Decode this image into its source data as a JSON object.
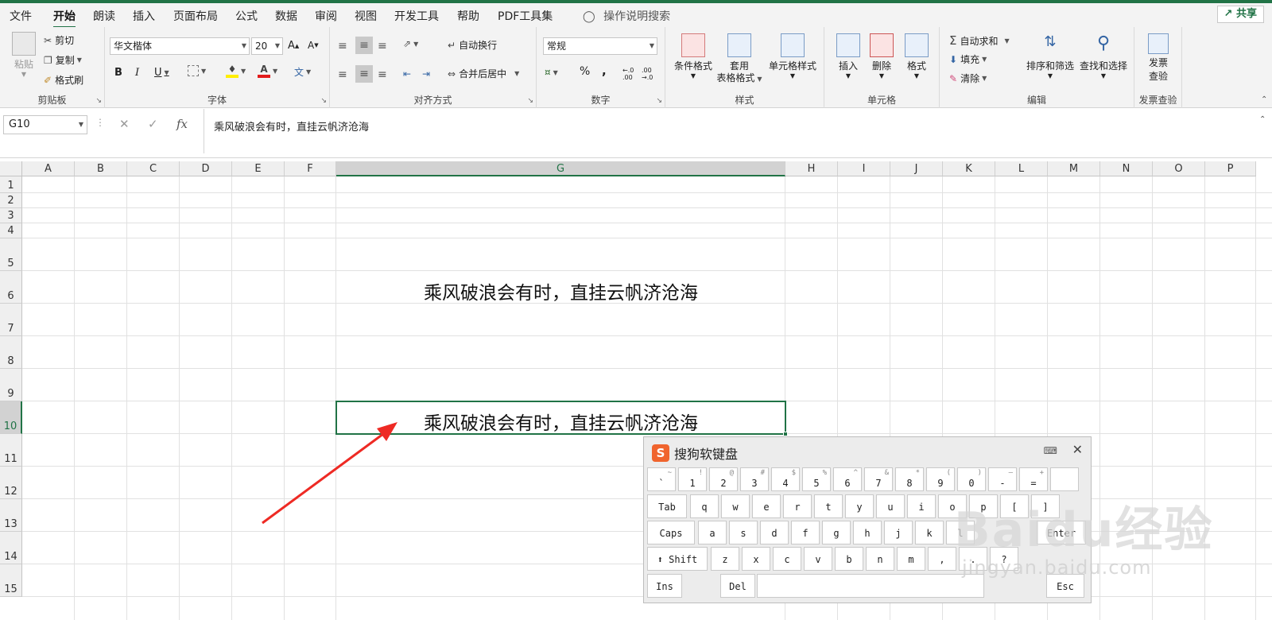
{
  "menu_tabs": [
    "文件",
    "开始",
    "朗读",
    "插入",
    "页面布局",
    "公式",
    "数据",
    "审阅",
    "视图",
    "开发工具",
    "帮助",
    "PDF工具集"
  ],
  "tell_me": "操作说明搜索",
  "share_label": "共享",
  "ribbon": {
    "clipboard": {
      "paste": "粘贴",
      "cut": "剪切",
      "copy": "复制",
      "format_painter": "格式刷",
      "label": "剪贴板"
    },
    "font": {
      "font_name": "华文楷体",
      "font_size": "20",
      "bold": "B",
      "italic": "I",
      "underline": "U",
      "label": "字体"
    },
    "alignment": {
      "wrap_text": "自动换行",
      "merge_center": "合并后居中",
      "label": "对齐方式"
    },
    "number": {
      "format": "常规",
      "percent": "%",
      "comma": ",",
      "label": "数字"
    },
    "styles": {
      "conditional": "条件格式",
      "table_format_1": "套用",
      "table_format_2": "表格格式",
      "cell_styles": "单元格样式",
      "label": "样式"
    },
    "cells": {
      "insert": "插入",
      "delete": "删除",
      "format": "格式",
      "label": "单元格"
    },
    "editing": {
      "autosum": "自动求和",
      "fill": "填充",
      "clear": "清除",
      "sort_filter": "排序和筛选",
      "find_select": "查找和选择",
      "label": "编辑"
    },
    "invoice": {
      "check_1": "发票",
      "check_2": "查验",
      "label": "发票查验"
    }
  },
  "formula_bar": {
    "name_box": "G10",
    "formula": "乘风破浪会有时，直挂云帆济沧海"
  },
  "columns": [
    "A",
    "B",
    "C",
    "D",
    "E",
    "F",
    "G",
    "H",
    "I",
    "J",
    "K",
    "L",
    "M",
    "N",
    "O",
    "P"
  ],
  "rows": [
    "1",
    "2",
    "3",
    "4",
    "5",
    "6",
    "7",
    "8",
    "9",
    "10",
    "11",
    "12",
    "13",
    "14",
    "15"
  ],
  "cells": {
    "G6": "乘风破浪会有时，直挂云帆济沧海",
    "G10": "乘风破浪会有时，直挂云帆济沧海"
  },
  "keyboard": {
    "title": "搜狗软键盘",
    "row1": [
      [
        "`",
        "~"
      ],
      [
        "1",
        "!"
      ],
      [
        "2",
        "@"
      ],
      [
        "3",
        "#"
      ],
      [
        "4",
        "$"
      ],
      [
        "5",
        "%"
      ],
      [
        "6",
        "^"
      ],
      [
        "7",
        "&"
      ],
      [
        "8",
        "*"
      ],
      [
        "9",
        "("
      ],
      [
        "0",
        ")"
      ],
      [
        "-",
        "—"
      ],
      [
        "=",
        "+"
      ],
      [
        "",
        ""
      ]
    ],
    "row2": [
      "Tab",
      "q",
      "w",
      "e",
      "r",
      "t",
      "y",
      "u",
      "i",
      "o",
      "p",
      "[",
      "]"
    ],
    "row3": [
      "Caps",
      "a",
      "s",
      "d",
      "f",
      "g",
      "h",
      "j",
      "k",
      "l",
      "Enter"
    ],
    "row4": [
      "⬆ Shift",
      "z",
      "x",
      "c",
      "v",
      "b",
      "n",
      "m",
      ",",
      ".",
      "?"
    ],
    "row5": [
      "Ins",
      "Del",
      "",
      "Esc"
    ]
  },
  "watermark": {
    "brand": "Baidu经验",
    "url": "jingyan.baidu.com"
  }
}
